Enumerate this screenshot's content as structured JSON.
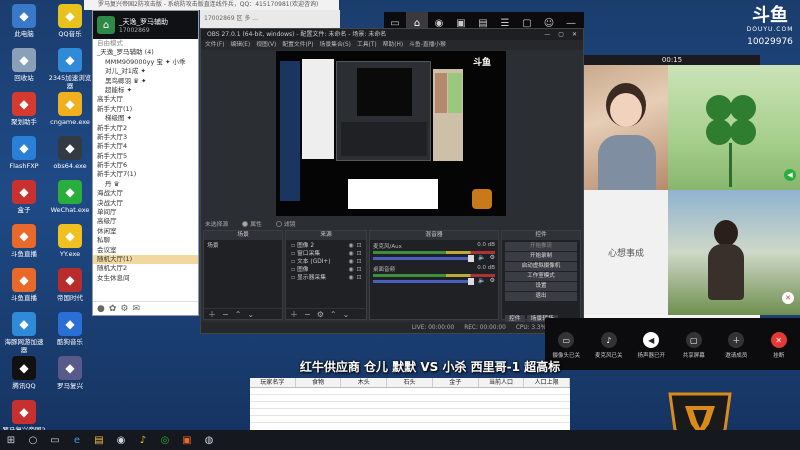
{
  "desktop_icons": [
    {
      "label": "此电脑",
      "icon": "computer-icon",
      "color": "#3a78c8"
    },
    {
      "label": "QQ音乐",
      "icon": "qqmusic-icon",
      "color": "#e7c21c"
    },
    {
      "label": "回收站",
      "icon": "recycle-bin-icon",
      "color": "#8aa0b8"
    },
    {
      "label": "2345加速浏览器",
      "icon": "browser-icon",
      "color": "#2f8ad8"
    },
    {
      "label": "聚划助手",
      "icon": "assistant-icon",
      "color": "#d63a2f"
    },
    {
      "label": "cngame.exe",
      "icon": "pacman-icon",
      "color": "#f0b020"
    },
    {
      "label": "FlashFXP",
      "icon": "flash-icon",
      "color": "#2a7fd6"
    },
    {
      "label": "obs64.exe",
      "icon": "obs-icon",
      "color": "#333a44"
    },
    {
      "label": "盒子",
      "icon": "box-icon",
      "color": "#c8312d"
    },
    {
      "label": "WeChat.exe",
      "icon": "wechat-icon",
      "color": "#2aae3b"
    },
    {
      "label": "斗鱼直播",
      "icon": "douyu-icon",
      "color": "#e8692a"
    },
    {
      "label": "YY.exe",
      "icon": "yy-icon",
      "color": "#f0c020"
    },
    {
      "label": "斗鱼直播",
      "icon": "douyu-icon",
      "color": "#e8692a"
    },
    {
      "label": "帝国时代",
      "icon": "empire-icon",
      "color": "#b82c2c"
    },
    {
      "label": "海豚网游加速器",
      "icon": "dolphin-icon",
      "color": "#2f8ad8"
    },
    {
      "label": "酷狗音乐",
      "icon": "kugou-icon",
      "color": "#2a6fd6"
    },
    {
      "label": "腾讯QQ",
      "icon": "qq-icon",
      "color": "#111111"
    },
    {
      "label": "罗马复兴",
      "icon": "rome-icon",
      "color": "#5a5a8a"
    },
    {
      "label": "罗马复兴帝国2防攻击",
      "icon": "game-icon",
      "color": "#c83030"
    }
  ],
  "browser": {
    "tab_text": "罗马复兴帝国2防攻击版 - 系统防攻击版直连线作兵，QQ：415170981(欢迎咨询)",
    "bar_text": "17002869 区 多 ..."
  },
  "qq_group": {
    "name": "_天逸_罗马辅助",
    "id": "17002869",
    "sections": [
      {
        "text": "自由模式",
        "kind": "head"
      },
      {
        "text": "_天逸_罗马辅助 (4)",
        "kind": "row"
      },
      {
        "text": "MMM909000yy 宝 ✦ 小乖",
        "kind": "sub"
      },
      {
        "text": "对儿_对1成 ✦",
        "kind": "sub"
      },
      {
        "text": "黑鸟卿羽 ♛ ✦",
        "kind": "sub"
      },
      {
        "text": "超能标 ✦",
        "kind": "sub"
      },
      {
        "text": "高手大厅",
        "kind": "row"
      },
      {
        "text": "新手大厅(1)",
        "kind": "row"
      },
      {
        "text": "梯级图 ✦",
        "kind": "sub"
      },
      {
        "text": "新手大厅2",
        "kind": "row"
      },
      {
        "text": "新手大厅3",
        "kind": "row"
      },
      {
        "text": "新手大厅4",
        "kind": "row"
      },
      {
        "text": "新手大厅5",
        "kind": "row"
      },
      {
        "text": "新手大厅6",
        "kind": "row"
      },
      {
        "text": "新手大厅7(1)",
        "kind": "row"
      },
      {
        "text": "丹 ♛",
        "kind": "sub"
      },
      {
        "text": "海战大厅",
        "kind": "row"
      },
      {
        "text": "决战大厅",
        "kind": "row"
      },
      {
        "text": "单间厅",
        "kind": "row"
      },
      {
        "text": "高级厅",
        "kind": "row"
      },
      {
        "text": "休闲室",
        "kind": "row"
      },
      {
        "text": "私聊",
        "kind": "row"
      },
      {
        "text": "会议室",
        "kind": "row"
      },
      {
        "text": "随机大厅(1)",
        "kind": "sel"
      },
      {
        "text": "随机大厅2",
        "kind": "row"
      },
      {
        "text": "女生休息间",
        "kind": "row"
      }
    ]
  },
  "obs": {
    "title": "OBS 27.0.1 (64-bit, windows) - 配置文件: 未命名 - 场景: 未命名",
    "menu": [
      "文件(F)",
      "编辑(E)",
      "视图(V)",
      "配置文件(P)",
      "场景集合(S)",
      "工具(T)",
      "帮助(H)",
      "斗鱼-直播小猴"
    ],
    "no_source": "未选择源",
    "radio_a": "属性",
    "radio_b": "滤镜",
    "docks": {
      "scenes": {
        "title": "场景",
        "items": [
          "场景"
        ]
      },
      "sources": {
        "title": "来源",
        "items": [
          "图像 2",
          "窗口采集",
          "文本 (GDI+)",
          "图像",
          "显示器采集"
        ]
      },
      "mixer": {
        "title": "混音器",
        "items": [
          {
            "name": "麦克风/Aux",
            "db": "0.0 dB"
          },
          {
            "name": "桌面音频",
            "db": "0.0 dB"
          }
        ]
      },
      "transitions": {
        "title": "转场"
      },
      "controls": {
        "title": "控件",
        "buttons": [
          "开始推流",
          "开始录制",
          "启动虚拟摄像机",
          "工作室模式",
          "设置",
          "退出"
        ]
      }
    },
    "tabs": [
      "控件",
      "场景转场"
    ],
    "status": {
      "live": "LIVE: 00:00:00",
      "rec": "REC: 00:00:00",
      "cpu": "CPU: 3.3%, 30.00 fps"
    }
  },
  "call": {
    "timer": "00:15",
    "wish_text": "心想事成",
    "buttons": [
      {
        "label": "摄像头已关",
        "icon": "camera-off-icon",
        "color": "#333333"
      },
      {
        "label": "麦克风已关",
        "icon": "mic-off-icon",
        "color": "#333333"
      },
      {
        "label": "扬声器已开",
        "icon": "speaker-icon",
        "color": "#ffffff"
      },
      {
        "label": "共享屏幕",
        "icon": "screen-share-icon",
        "color": "#333333"
      },
      {
        "label": "邀请成员",
        "icon": "add-member-icon",
        "color": "#333333"
      },
      {
        "label": "挂断",
        "icon": "hangup-icon",
        "color": "#e53935"
      }
    ]
  },
  "douyu": {
    "logo": "斗鱼",
    "sub": "DOUYU.COM",
    "room_id": "10029976"
  },
  "caption": "红牛供应商 仓儿 默默 VS 小杀 西里哥-1 超高标",
  "sheet": {
    "headers": [
      "玩家名字",
      "食物",
      "木头",
      "石头",
      "金子",
      "当前人口",
      "人口上限"
    ]
  }
}
